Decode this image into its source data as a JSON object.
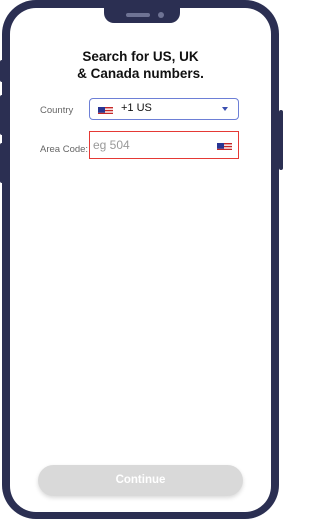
{
  "heading": {
    "line1": "Search for US, UK",
    "line2": "& Canada numbers."
  },
  "form": {
    "country_label": "Country",
    "country_value": "+1 US",
    "country_flag_icon": "us-flag-icon",
    "area_label": "Area Code:",
    "area_placeholder": "eg 504",
    "area_value": "",
    "area_flag_icon": "us-flag-icon"
  },
  "footer": {
    "continue_label": "Continue"
  },
  "colors": {
    "frame": "#2b2f52",
    "select_border": "#6d7fd6",
    "input_error_border": "#e53935",
    "button_disabled": "#d9d9d9"
  }
}
